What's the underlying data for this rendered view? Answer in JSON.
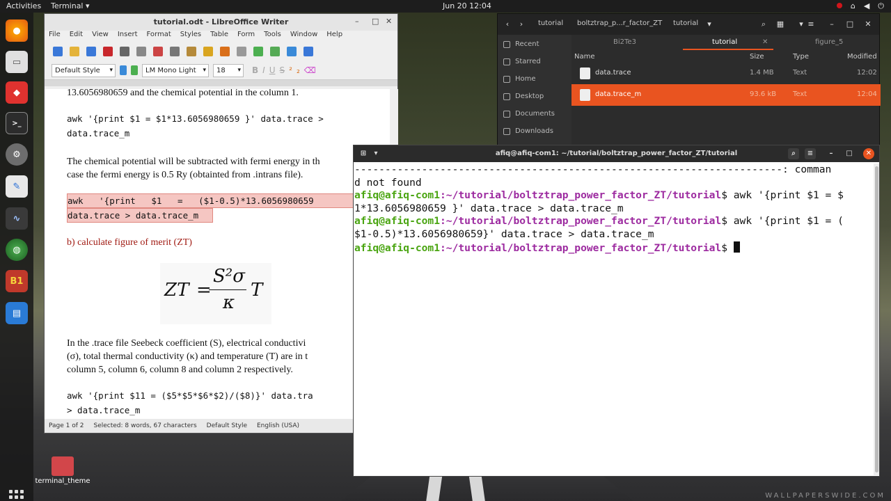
{
  "topbar": {
    "activities": "Activities",
    "app": "Terminal ▾",
    "clock": "Jun 20  12:04",
    "tray_icons": [
      "record-icon",
      "network-icon",
      "volume-icon",
      "power-icon"
    ]
  },
  "dock": {
    "items": [
      "firefox-icon",
      "files-icon",
      "anydesk-icon",
      "terminal-icon",
      "settings-icon",
      "text-editor-icon",
      "system-monitor-icon",
      "globe-icon",
      "b1-app-icon",
      "writer-icon"
    ],
    "b1_label": "B1"
  },
  "desktop": {
    "folder_label": "terminal_theme",
    "watermark": "WALLPAPERSWIDE.COM"
  },
  "writer": {
    "title": "tutorial.odt - LibreOffice Writer",
    "menu": [
      "File",
      "Edit",
      "View",
      "Insert",
      "Format",
      "Styles",
      "Table",
      "Form",
      "Tools",
      "Window",
      "Help"
    ],
    "para_style": "Default Style",
    "font": "LM Mono Light",
    "size": "18",
    "doc": {
      "line0": "13.6056980659 and the chemical potential in the column 1.",
      "awk1a": "awk '{print $1 = $1*13.6056980659 }' data.trace >",
      "awk1b": "data.trace_m",
      "para2a": "The chemical potential will be subtracted with fermi energy in th",
      "para2b": "case the fermi energy is 0.5 Ry (obtainted from .intrans file).",
      "awk2a": "awk   '{print   $1   =   ($1-0.5)*13.6056980659",
      "awk2b": "data.trace > data.trace_m",
      "heading": "b) calculate figure of merit (ZT)",
      "f_zt": "ZT",
      "f_eq": "=",
      "f_num": "S²σ",
      "f_den": "κ",
      "f_t": "T",
      "para3a": "In the .trace file Seebeck coefficient (S), electrical conductivi",
      "para3b": "(σ), total thermal conductivity (κ) and temperature (T) are in t",
      "para3c": "column 5, column 6, column 8 and column 2 respectively.",
      "awk3a": "awk '{print $11 = ($5*$5*$6*$2)/($8)}' data.tra",
      "awk3b": "> data.trace_m"
    },
    "status": {
      "page": "Page 1 of 2",
      "selected": "Selected: 8 words, 67 characters",
      "style": "Default Style",
      "lang": "English (USA)"
    }
  },
  "files": {
    "breadcrumb": [
      "tutorial",
      "boltztrap_p...r_factor_ZT",
      "tutorial"
    ],
    "sidebar": [
      "Recent",
      "Starred",
      "Home",
      "Desktop",
      "Documents",
      "Downloads"
    ],
    "tabs": [
      "Bi2Te3",
      "tutorial",
      "figure_5"
    ],
    "columns": [
      "Name",
      "Size",
      "Type",
      "Modified"
    ],
    "rows": [
      {
        "name": "data.trace",
        "size": "1.4 MB",
        "type": "Text",
        "modified": "12:02"
      },
      {
        "name": "data.trace_m",
        "size": "93.6 kB",
        "type": "Text",
        "modified": "12:04"
      }
    ]
  },
  "terminal": {
    "title": "afiq@afiq-com1: ~/tutorial/boltztrap_power_factor_ZT/tutorial",
    "line1": "----------------------------------------------------------------------: comman",
    "line2": "d not found",
    "user": "afiq@afiq-com1",
    "path": ":~/tutorial/boltztrap_power_factor_ZT/tutorial",
    "cmd1": "$ awk '{print $1 = $",
    "cmd1b": "1*13.6056980659 }' data.trace > data.trace_m",
    "cmd2": "$ awk '{print $1 = (",
    "cmd2b": "$1-0.5)*13.6056980659}' data.trace > data.trace_m",
    "cmd3": "$ "
  }
}
